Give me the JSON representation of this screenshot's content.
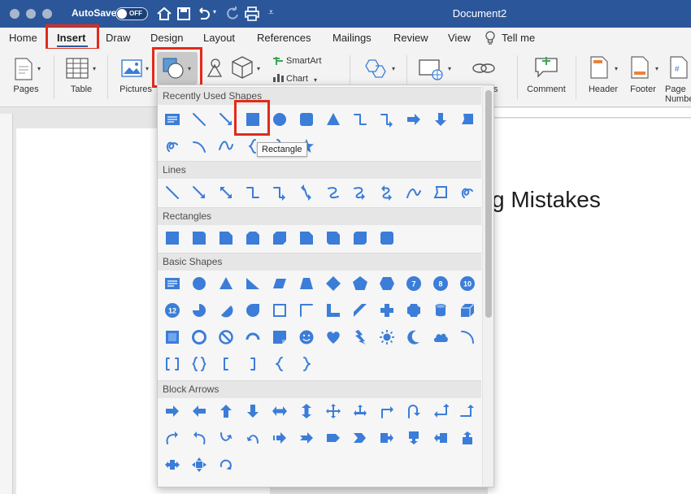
{
  "window": {
    "autosave_label": "AutoSave",
    "autosave_state": "OFF",
    "doc_title": "Document2"
  },
  "tabs": [
    "Home",
    "Insert",
    "Draw",
    "Design",
    "Layout",
    "References",
    "Mailings",
    "Review",
    "View"
  ],
  "tell_me": "Tell me",
  "ribbon": {
    "pages": "Pages",
    "table": "Table",
    "pictures": "Pictures",
    "smartart": "SmartArt",
    "chart": "Chart",
    "links_partial": "ts",
    "comment": "Comment",
    "header": "Header",
    "footer": "Footer",
    "page_number": "Page Number"
  },
  "document": {
    "visible_text": "g Mistakes"
  },
  "shapes_panel": {
    "sections": [
      "Recently Used Shapes",
      "Lines",
      "Rectangles",
      "Basic Shapes",
      "Block Arrows"
    ],
    "tooltip": "Rectangle",
    "basic_numbers": [
      "7",
      "8",
      "10",
      "12"
    ]
  },
  "colors": {
    "title_bar": "#2b579a",
    "shape_fill": "#3b7dd8",
    "highlight": "#e12b1a"
  }
}
